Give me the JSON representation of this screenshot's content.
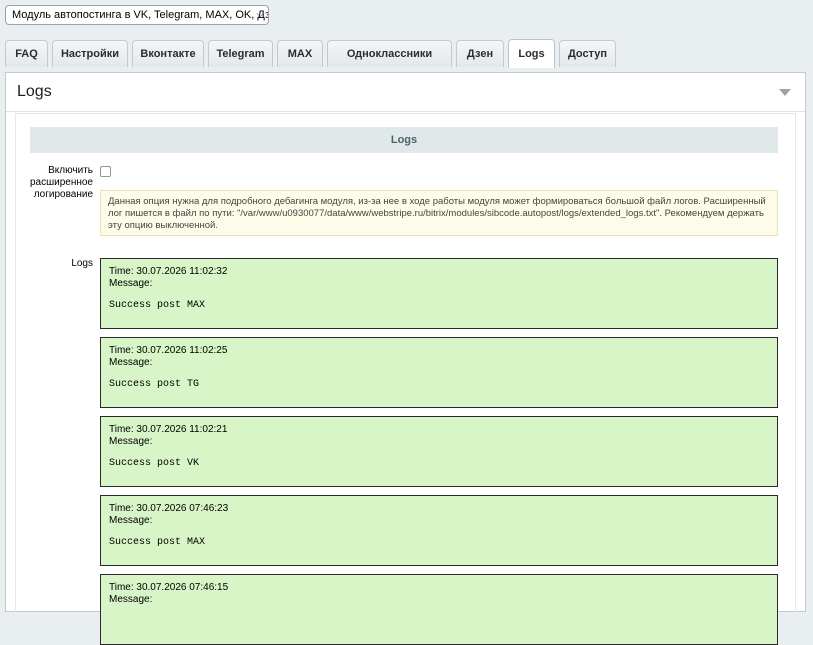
{
  "module_select": {
    "value": "Модуль автопостинга в VK, Telegram, MAX, OK, Дзен"
  },
  "tabs": [
    {
      "label": "FAQ"
    },
    {
      "label": "Настройки"
    },
    {
      "label": "Вконтакте"
    },
    {
      "label": "Telegram"
    },
    {
      "label": "MAX"
    },
    {
      "label": "Одноклассники"
    },
    {
      "label": "Дзен"
    },
    {
      "label": "Logs"
    },
    {
      "label": "Доступ"
    }
  ],
  "active_tab": "Logs",
  "panel": {
    "title": "Logs"
  },
  "section": {
    "title": "Logs"
  },
  "extended_logging": {
    "label": "Включить расширенное логирование",
    "checked": false,
    "notice": "Данная опция нужна для подробного дебагинга модуля, из-за нее в ходе работы модуля может формироваться большой файл логов. Расширенный лог пишется в файл по пути: \"/var/www/u0930077/data/www/webstripe.ru/bitrix/modules/sibcode.autopost/logs/extended_logs.txt\". Рекомендуем держать эту опцию выключенной."
  },
  "logs_label": "Logs",
  "logs": [
    {
      "time": "Time: 30.07.2026 11:02:32",
      "message_label": "Message:",
      "message": "Success post MAX"
    },
    {
      "time": "Time: 30.07.2026 11:02:25",
      "message_label": "Message:",
      "message": "Success post TG"
    },
    {
      "time": "Time: 30.07.2026 11:02:21",
      "message_label": "Message:",
      "message": "Success post VK"
    },
    {
      "time": "Time: 30.07.2026 07:46:23",
      "message_label": "Message:",
      "message": "Success post MAX"
    },
    {
      "time": "Time: 30.07.2026 07:46:15",
      "message_label": "Message:",
      "message": ""
    }
  ],
  "colors": {
    "log_bg": "#d7f5c7",
    "section_bar_bg": "#e0e8ea",
    "notice_bg": "#fefce8"
  }
}
